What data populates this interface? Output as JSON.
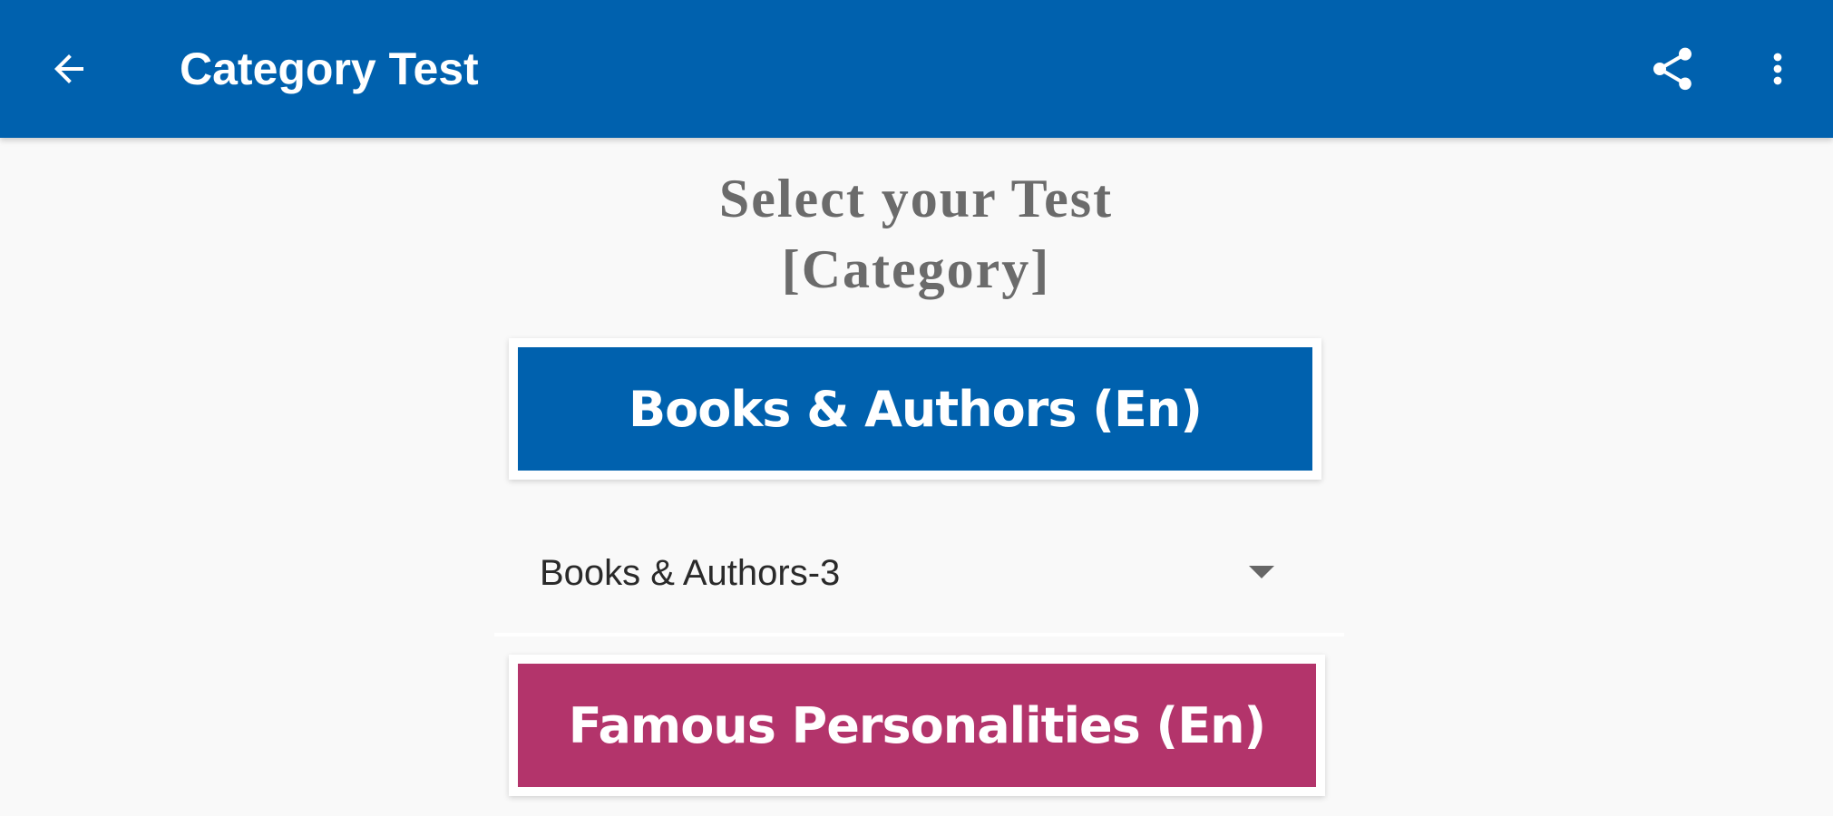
{
  "appbar": {
    "title": "Category Test",
    "back_icon": "arrow-back-icon",
    "share_icon": "share-icon",
    "more_icon": "more-vert-icon",
    "color": "#0061ae"
  },
  "main": {
    "heading_line1": "Select your Test",
    "heading_line2": "[Category]",
    "categories": [
      {
        "label": "Books & Authors (En)",
        "color": "#0061ae"
      },
      {
        "label": "Famous Personalities (En)",
        "color": "#b3346b"
      }
    ],
    "dropdown": {
      "selected": "Books & Authors-3",
      "icon": "chevron-down-icon"
    }
  }
}
